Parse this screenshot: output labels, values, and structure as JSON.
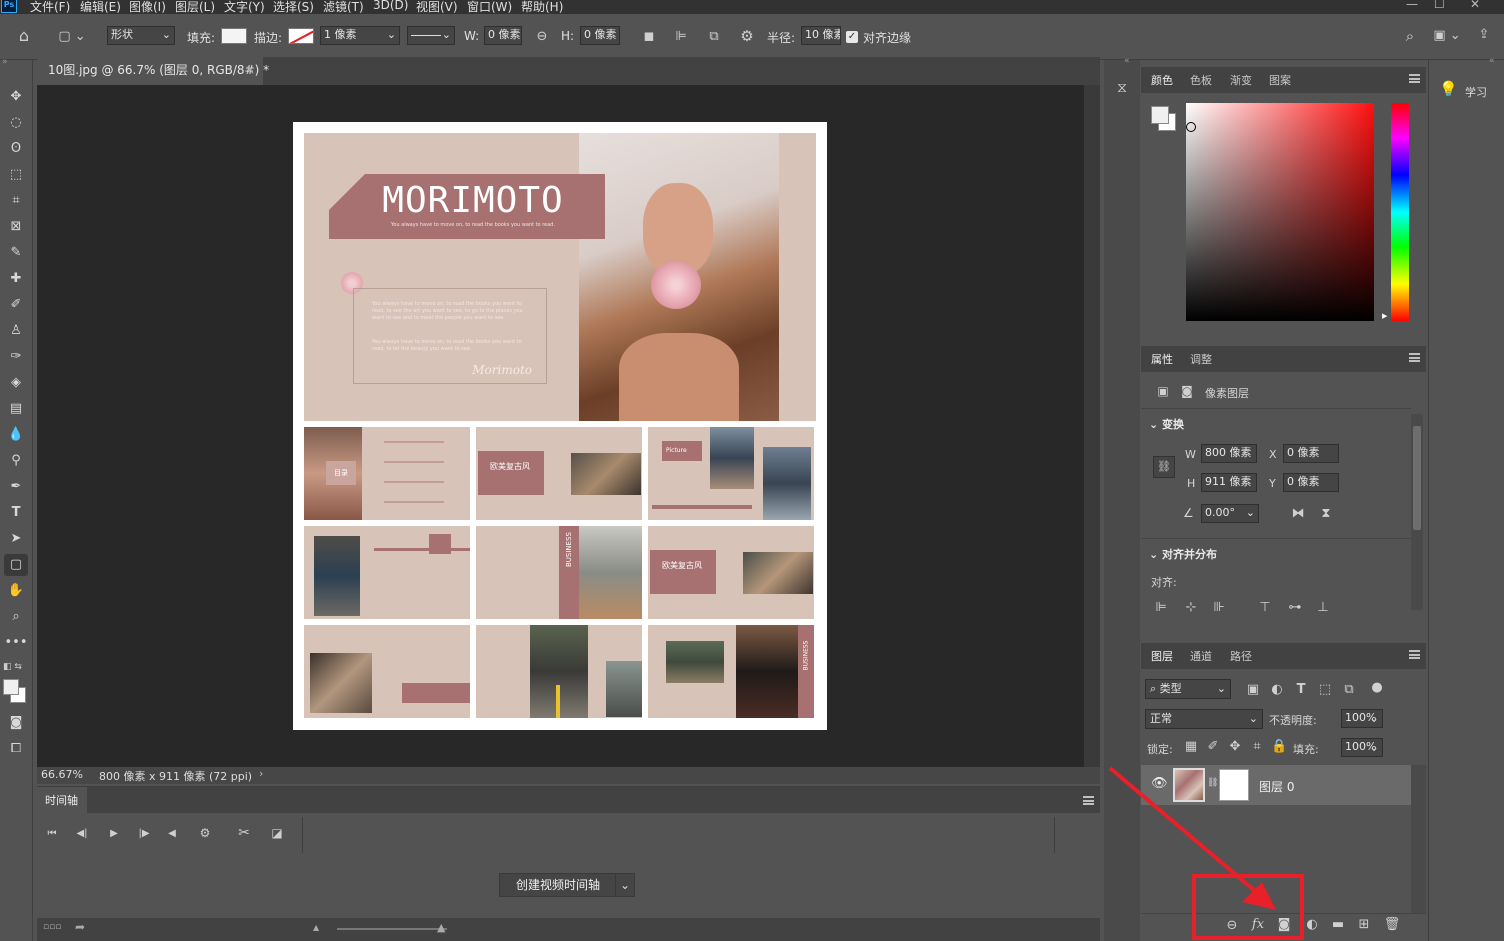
{
  "menu": {
    "items": [
      "文件(F)",
      "编辑(E)",
      "图像(I)",
      "图层(L)",
      "文字(Y)",
      "选择(S)",
      "滤镜(T)",
      "3D(D)",
      "视图(V)",
      "窗口(W)",
      "帮助(H)"
    ],
    "app_badge": "Ps"
  },
  "options": {
    "shape_mode": "形状",
    "fill_label": "填充:",
    "stroke_label": "描边:",
    "stroke_width": "1 像素",
    "w_label": "W:",
    "w_value": "0 像素",
    "h_label": "H:",
    "h_value": "0 像素",
    "radius_label": "半径:",
    "radius_value": "10 像素",
    "align_edges_label": "对齐边缘"
  },
  "document": {
    "tab_title": "10图.jpg @ 66.7% (图层 0, RGB/8#) *",
    "zoom": "66.67%",
    "size_info": "800 像素 x 911 像素 (72 ppi)",
    "title_text": "MORIMOTO",
    "subtitle_text": "You always have to move on, to read the books you want to read.",
    "body_text": "You always have to move on, to read the books you want to read, to see the art you want to see, to go to the places you want to see and to meet the people you want to see.",
    "body_text2": "You always have to move on, to read the books you want to read, to let the beauty you want to see.",
    "signature": "Morimoto",
    "thumb_labels": [
      "目录",
      "欧美复古风",
      "Picture",
      "BUSINESS",
      "欧美复古风",
      "BUSINESS"
    ]
  },
  "timeline": {
    "title": "时间轴",
    "create_button": "创建视频时间轴"
  },
  "color_panel": {
    "tabs": [
      "颜色",
      "色板",
      "渐变",
      "图案"
    ]
  },
  "properties_panel": {
    "tabs": [
      "属性",
      "调整"
    ],
    "layer_type": "像素图层",
    "transform_title": "变换",
    "w_label": "W",
    "w_value": "800 像素",
    "h_label": "H",
    "h_value": "911 像素",
    "x_label": "X",
    "x_value": "0 像素",
    "y_label": "Y",
    "y_value": "0 像素",
    "angle_value": "0.00°",
    "align_title": "对齐并分布",
    "align_label": "对齐:"
  },
  "layers_panel": {
    "tabs": [
      "图层",
      "通道",
      "路径"
    ],
    "filter_kind": "类型",
    "blend_mode": "正常",
    "opacity_label": "不透明度:",
    "opacity_value": "100%",
    "lock_label": "锁定:",
    "fill_label": "填充:",
    "fill_value": "100%",
    "layer_name": "图层 0"
  },
  "learn_panel": {
    "label": "学习"
  },
  "colors": {
    "accent_rose": "#a77171",
    "beige": "#d8c3b8",
    "highlight_red": "#e8202a"
  }
}
